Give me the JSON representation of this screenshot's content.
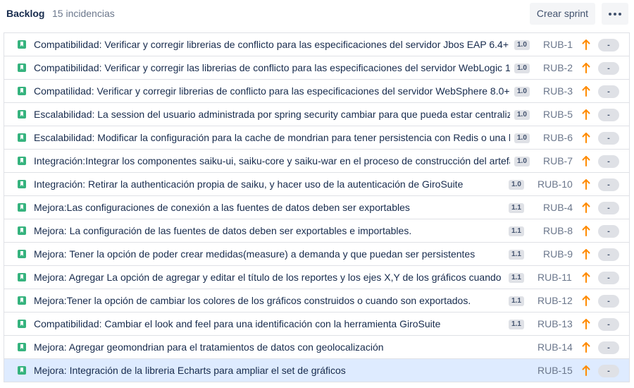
{
  "header": {
    "title": "Backlog",
    "count": "15 incidencias",
    "create_sprint_label": "Crear sprint",
    "more_icon": "more-horizontal-icon"
  },
  "colors": {
    "story": "#36b37e",
    "priority_high": "#ff8b00",
    "selected_row": "#deebff"
  },
  "issues": [
    {
      "summary": "Compatibilidad: Verificar y corregir librerias de conflicto para las especificaciones del servidor Jbos EAP 6.4+",
      "version": "1.0",
      "key": "RUB-1",
      "estimate": "-"
    },
    {
      "summary": "Compatibilidad: Verificar y corregir las librerias de conflicto para las especificaciones del servidor WebLogic 1",
      "version": "1.0",
      "key": "RUB-2",
      "estimate": "-"
    },
    {
      "summary": "Compatilidad: Verificar y corregir librerias de conflicto para las especificaciones del servidor WebSphere 8.0+",
      "version": "1.0",
      "key": "RUB-3",
      "estimate": "-"
    },
    {
      "summary": "Escalabilidad: La session del usuario administrada por spring security cambiar para que pueda estar centraliz",
      "version": "1.0",
      "key": "RUB-5",
      "estimate": "-"
    },
    {
      "summary": "Escalabilidad: Modificar la configuración para la cache de mondrian para tener persistencia con Redis o una b",
      "version": "1.0",
      "key": "RUB-6",
      "estimate": "-"
    },
    {
      "summary": "Integración:Integrar los componentes saiku-ui, saiku-core y saiku-war en el proceso de construcción del artefa",
      "version": "1.0",
      "key": "RUB-7",
      "estimate": "-"
    },
    {
      "summary": "Integración: Retirar la authenticación propia de saiku, y hacer uso de la autenticación de GiroSuite",
      "version": "1.0",
      "key": "RUB-10",
      "estimate": "-"
    },
    {
      "summary": "Mejora:Las configuraciones de conexión a las fuentes de datos deben ser exportables",
      "version": "1.1",
      "key": "RUB-4",
      "estimate": "-"
    },
    {
      "summary": "Mejora: La configuración de las fuentes de datos deben ser exportables e importables.",
      "version": "1.1",
      "key": "RUB-8",
      "estimate": "-"
    },
    {
      "summary": "Mejora: Tener la opción de poder crear medidas(measure) a demanda y que puedan ser persistentes",
      "version": "1.1",
      "key": "RUB-9",
      "estimate": "-"
    },
    {
      "summary": "Mejora: Agregar La opción de agregar y editar el título de los reportes y los ejes X,Y de los gráficos cuando s",
      "version": "1.1",
      "key": "RUB-11",
      "estimate": "-"
    },
    {
      "summary": "Mejora:Tener la opción de cambiar los colores de los gráficos construidos o cuando son exportados.",
      "version": "1.1",
      "key": "RUB-12",
      "estimate": "-"
    },
    {
      "summary": "Compatibilidad: Cambiar el look and feel para una identificación con la herramienta GiroSuite",
      "version": "1.1",
      "key": "RUB-13",
      "estimate": "-"
    },
    {
      "summary": "Mejora: Agregar geomondrian para el tratamientos de datos con geolocalización",
      "version": "",
      "key": "RUB-14",
      "estimate": "-"
    },
    {
      "summary": "Mejora: Integración de la libreria Echarts para ampliar el set de gráficos",
      "version": "",
      "key": "RUB-15",
      "estimate": "-",
      "selected": true
    }
  ]
}
